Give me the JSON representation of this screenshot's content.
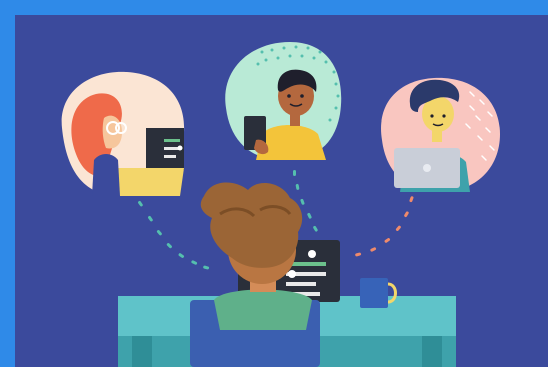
{
  "scene": {
    "colors": {
      "outer_frame": "#2f8ae8",
      "background": "#3b4a9c",
      "desk": "#5fc3c9",
      "desk_dark": "#3ea2ab",
      "chair": "#3b5fb0",
      "mug": "#3763b8",
      "monitor": "#2a2f3a",
      "hair_main": "#9b6536",
      "bubble_left": "#fbe5d4",
      "bubble_center": "#b9ead6",
      "bubble_right": "#f9c6c0",
      "dots": "#55bfae"
    },
    "participants": [
      {
        "icon": "woman-with-glasses-at-laptop-icon",
        "name_visible": false
      },
      {
        "icon": "man-holding-tablet-icon",
        "name_visible": false
      },
      {
        "icon": "man-with-laptop-icon",
        "name_visible": false
      }
    ],
    "main_person_icon": "person-at-computer-back-view-icon"
  }
}
